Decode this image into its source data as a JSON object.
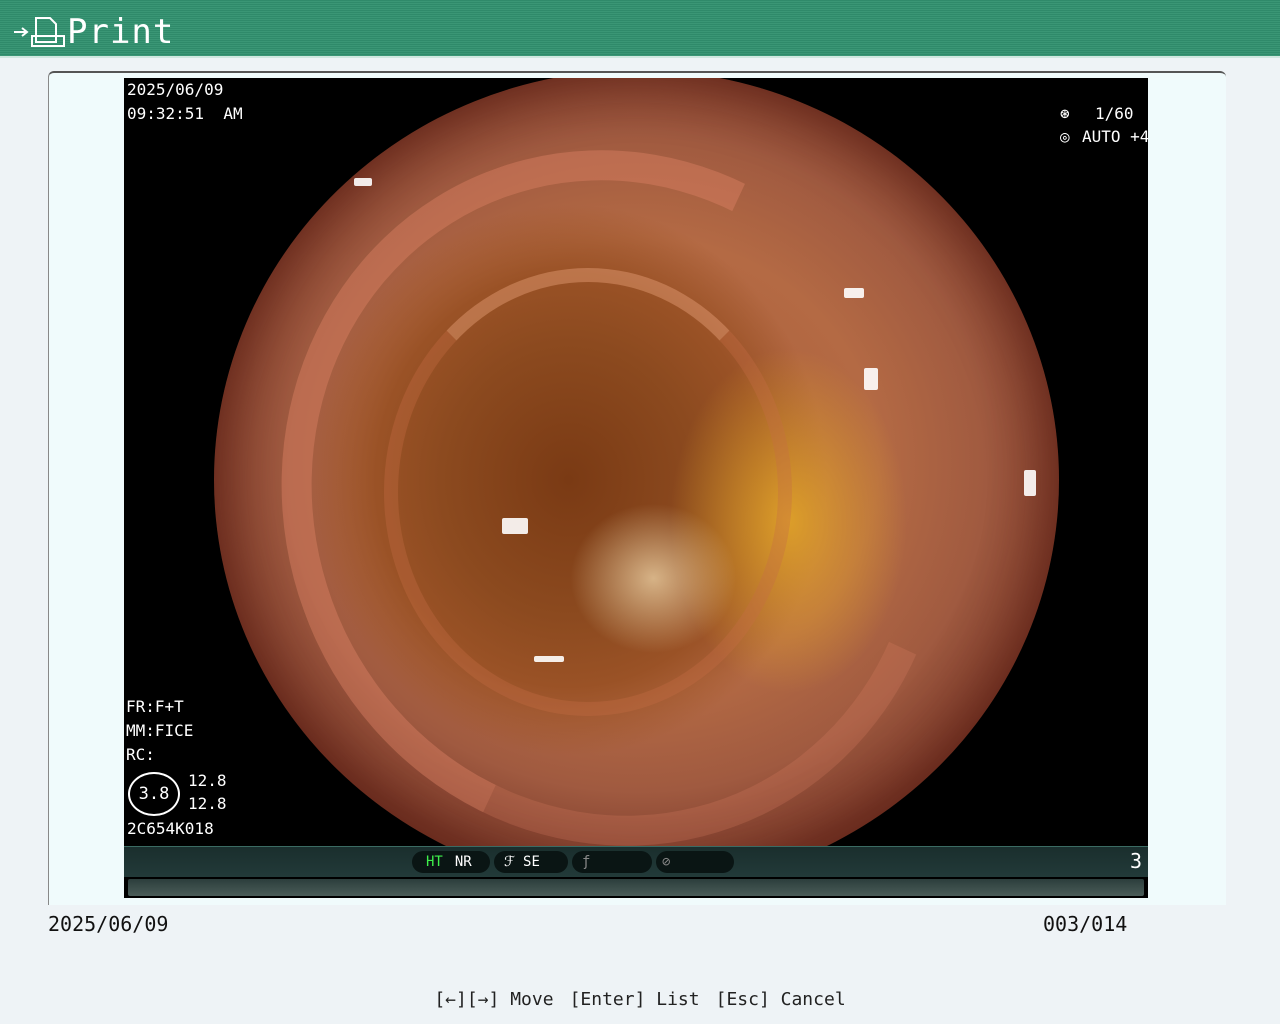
{
  "header": {
    "title": "Print",
    "icon": "print-arrow-icon"
  },
  "image": {
    "date": "2025/06/09",
    "time": "09:32:51  AM",
    "shutter": "1/60",
    "exposure": "AUTO +4",
    "fr": "FR:F+T",
    "mm": "MM:FICE",
    "rc": "RC:",
    "ratio": "3.8",
    "ratio_top": "12.8",
    "ratio_bottom": "12.8",
    "scope_id": "2C654K018",
    "status": {
      "ht": "HT",
      "nr": "NR",
      "se": "SE",
      "page": "3"
    }
  },
  "info": {
    "date": "2025/06/09",
    "counter": "003/014"
  },
  "footer": {
    "move": "[←][→] Move",
    "list": "[Enter] List",
    "cancel": "[Esc] Cancel"
  }
}
